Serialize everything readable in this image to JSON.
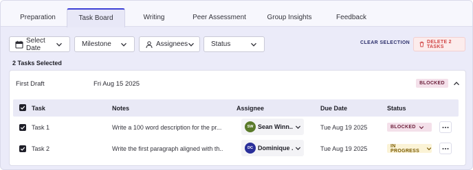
{
  "tabs": [
    {
      "label": "Preparation",
      "active": false
    },
    {
      "label": "Task Board",
      "active": true
    },
    {
      "label": "Writing",
      "active": false
    },
    {
      "label": "Peer Assessment",
      "active": false
    },
    {
      "label": "Group Insights",
      "active": false
    },
    {
      "label": "Feedback",
      "active": false
    }
  ],
  "filters": {
    "date": {
      "label": "Select Date",
      "icon": "calendar-icon"
    },
    "milestone": {
      "label": "Milestone"
    },
    "assignees": {
      "label": "Assignees",
      "icon": "person-icon"
    },
    "status": {
      "label": "Status"
    }
  },
  "actions": {
    "clear_label": "CLEAR SELECTION",
    "delete_label": "DELETE 2 TASKS",
    "delete_icon": "trash-icon"
  },
  "selection_summary": "2 Tasks Selected",
  "group": {
    "title": "First Draft",
    "date": "Fri Aug 15 2025",
    "status": "BLOCKED",
    "columns": {
      "task": "Task",
      "notes": "Notes",
      "assignee": "Assignee",
      "due_date": "Due Date",
      "status": "Status"
    },
    "rows": [
      {
        "task": "Task 1",
        "notes": "Write a 100 word description for the pr...",
        "assignee_initials": "SW",
        "assignee_name": "Sean Winn...",
        "avatar_color": "#5a7a2a",
        "due_date": "Tue Aug 19 2025",
        "status": "BLOCKED",
        "status_bg": "#f4e0ea",
        "status_color": "#6b1f3a",
        "checked": true
      },
      {
        "task": "Task 2",
        "notes": "Write the first paragraph aligned with th...",
        "assignee_initials": "DC",
        "assignee_name": "Dominique ...",
        "avatar_color": "#2a2f9a",
        "due_date": "Tue Aug 19 2025",
        "status": "IN PROGRESS",
        "status_bg": "#fbf3d6",
        "status_color": "#7a5a00",
        "checked": true
      }
    ]
  },
  "colors": {
    "accent": "#3b3fd6",
    "danger": "#d04545",
    "page_bg": "#ebebf9"
  }
}
